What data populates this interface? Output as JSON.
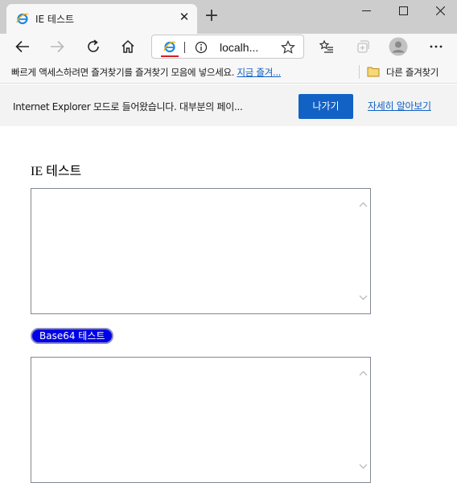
{
  "tab": {
    "title": "IE 테스트",
    "close_glyph": "✕",
    "favicon": "ie-icon"
  },
  "new_tab_glyph": "+",
  "address": {
    "url": "localh..."
  },
  "favorites_bar": {
    "prompt": "빠르게 액세스하려면 즐겨찾기를 즐겨찾기 모음에 넣으세요.",
    "link": "지금 즐겨...",
    "other": "다른 즐겨찾기"
  },
  "infobar": {
    "message": "Internet Explorer 모드로 들어왔습니다. 대부분의 페이...",
    "button": "나가기",
    "learn_more": "자세히 알아보기"
  },
  "page": {
    "heading": "IE 테스트",
    "base64_button": "Base64 테스트"
  },
  "colors": {
    "accent": "#1261c4",
    "link": "#1061c5",
    "base64_button_bg": "#0000e6",
    "ie_mode_underline": "#d21f1f"
  }
}
